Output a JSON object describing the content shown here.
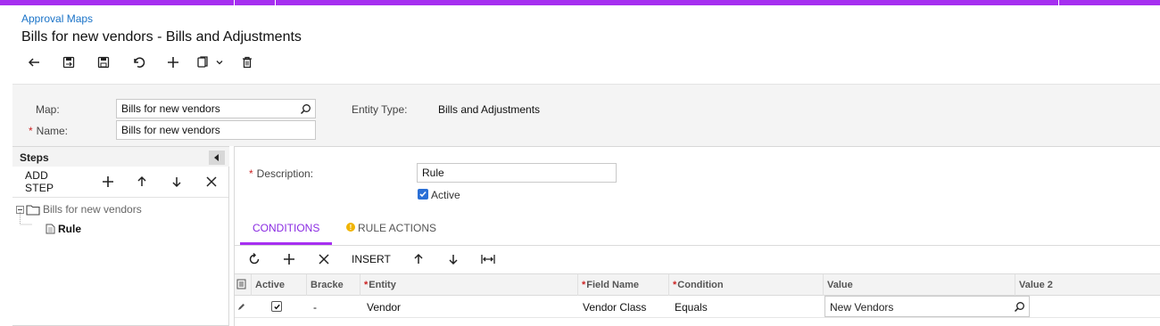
{
  "colors": {
    "accent": "#a62ff0",
    "link": "#1a73c8",
    "checkbox": "#2a6fd6"
  },
  "breadcrumb": "Approval Maps",
  "page_title": "Bills for new vendors - Bills and Adjustments",
  "toolbar": {
    "icons": [
      "back-icon",
      "save-and-close-icon",
      "save-icon",
      "undo-icon",
      "add-icon",
      "copy-paste-icon",
      "delete-icon"
    ]
  },
  "header_form": {
    "map_label": "Map:",
    "map_value": "Bills for new vendors",
    "name_label": "Name:",
    "name_value": "Bills for new vendors",
    "entity_type_label": "Entity Type:",
    "entity_type_value": "Bills and Adjustments"
  },
  "steps": {
    "title": "Steps",
    "add_step": "ADD STEP",
    "tree_root": "Bills for new vendors",
    "tree_leaf": "Rule"
  },
  "rule": {
    "description_label": "Description:",
    "description_value": "Rule",
    "active_label": "Active",
    "active_checked": true
  },
  "tabs": {
    "conditions": "CONDITIONS",
    "rule_actions": "RULE ACTIONS",
    "warning_glyph": "!"
  },
  "grid": {
    "insert_label": "INSERT",
    "columns": {
      "active": "Active",
      "brackets": "Bracke",
      "entity": "Entity",
      "field_name": "Field Name",
      "condition": "Condition",
      "value": "Value",
      "value2": "Value 2"
    },
    "rows": [
      {
        "active": true,
        "brackets": "-",
        "entity": "Vendor",
        "field_name": "Vendor Class",
        "condition": "Equals",
        "value": "New Vendors",
        "value2": ""
      }
    ]
  }
}
